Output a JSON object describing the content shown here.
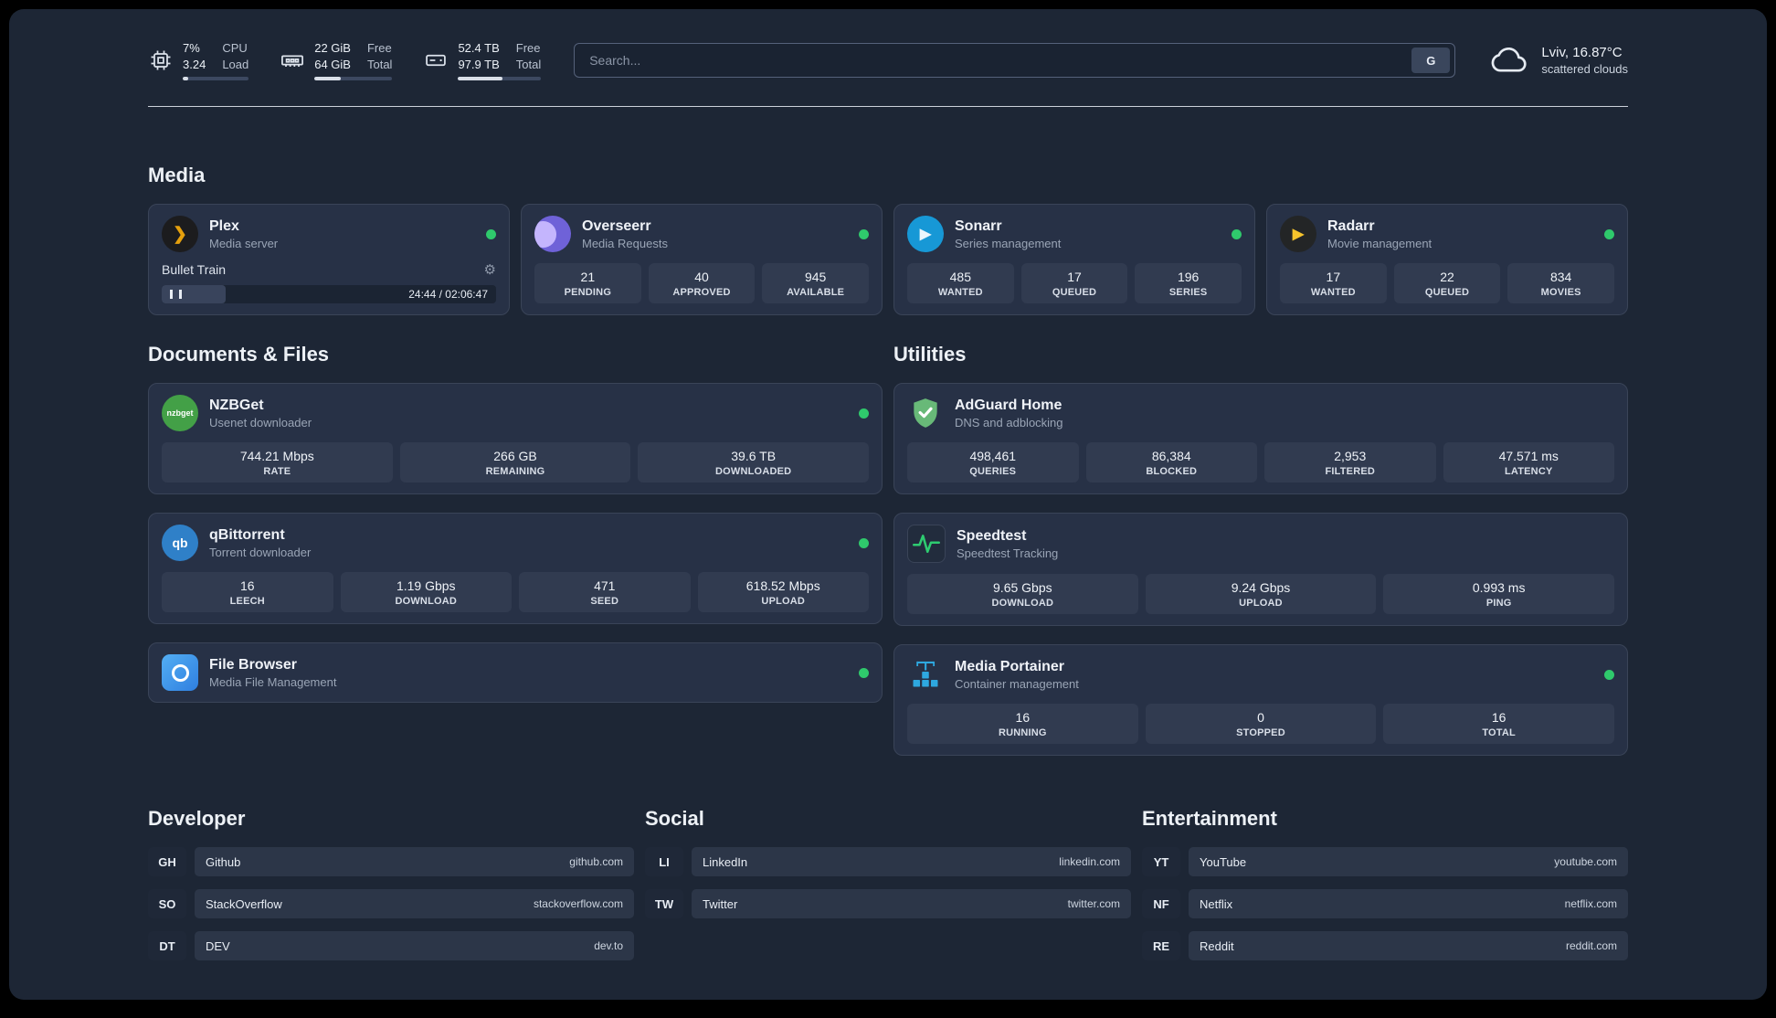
{
  "topbar": {
    "cpu": {
      "pct": "7%",
      "load": "3.24",
      "label_top": "CPU",
      "label_bottom": "Load",
      "bar_width": "8%"
    },
    "ram": {
      "free": "22 GiB",
      "total": "64 GiB",
      "label_top": "Free",
      "label_bottom": "Total",
      "bar_width": "34%"
    },
    "disk": {
      "free": "52.4 TB",
      "total": "97.9 TB",
      "label_top": "Free",
      "label_bottom": "Total",
      "bar_width": "53%"
    },
    "search_placeholder": "Search...",
    "search_engine": "G",
    "weather_location": "Lviv, 16.87°C",
    "weather_condition": "scattered clouds"
  },
  "media": {
    "title": "Media",
    "plex": {
      "name": "Plex",
      "desc": "Media server",
      "now_playing": "Bullet Train",
      "time": "24:44 / 02:06:47",
      "progress_width": "19%"
    },
    "overseerr": {
      "name": "Overseerr",
      "desc": "Media Requests",
      "stats": [
        {
          "value": "21",
          "label": "PENDING"
        },
        {
          "value": "40",
          "label": "APPROVED"
        },
        {
          "value": "945",
          "label": "AVAILABLE"
        }
      ]
    },
    "sonarr": {
      "name": "Sonarr",
      "desc": "Series management",
      "stats": [
        {
          "value": "485",
          "label": "WANTED"
        },
        {
          "value": "17",
          "label": "QUEUED"
        },
        {
          "value": "196",
          "label": "SERIES"
        }
      ]
    },
    "radarr": {
      "name": "Radarr",
      "desc": "Movie management",
      "stats": [
        {
          "value": "17",
          "label": "WANTED"
        },
        {
          "value": "22",
          "label": "QUEUED"
        },
        {
          "value": "834",
          "label": "MOVIES"
        }
      ]
    }
  },
  "documents": {
    "title": "Documents & Files",
    "nzbget": {
      "name": "NZBGet",
      "desc": "Usenet downloader",
      "stats": [
        {
          "value": "744.21 Mbps",
          "label": "RATE"
        },
        {
          "value": "266 GB",
          "label": "REMAINING"
        },
        {
          "value": "39.6 TB",
          "label": "DOWNLOADED"
        }
      ]
    },
    "qbittorrent": {
      "name": "qBittorrent",
      "desc": "Torrent downloader",
      "stats": [
        {
          "value": "16",
          "label": "LEECH"
        },
        {
          "value": "1.19 Gbps",
          "label": "DOWNLOAD"
        },
        {
          "value": "471",
          "label": "SEED"
        },
        {
          "value": "618.52 Mbps",
          "label": "UPLOAD"
        }
      ]
    },
    "filebrowser": {
      "name": "File Browser",
      "desc": "Media File Management"
    }
  },
  "utilities": {
    "title": "Utilities",
    "adguard": {
      "name": "AdGuard Home",
      "desc": "DNS and adblocking",
      "stats": [
        {
          "value": "498,461",
          "label": "QUERIES"
        },
        {
          "value": "86,384",
          "label": "BLOCKED"
        },
        {
          "value": "2,953",
          "label": "FILTERED"
        },
        {
          "value": "47.571 ms",
          "label": "LATENCY"
        }
      ]
    },
    "speedtest": {
      "name": "Speedtest",
      "desc": "Speedtest Tracking",
      "stats": [
        {
          "value": "9.65 Gbps",
          "label": "DOWNLOAD"
        },
        {
          "value": "9.24 Gbps",
          "label": "UPLOAD"
        },
        {
          "value": "0.993 ms",
          "label": "PING"
        }
      ]
    },
    "portainer": {
      "name": "Media Portainer",
      "desc": "Container management",
      "stats": [
        {
          "value": "16",
          "label": "RUNNING"
        },
        {
          "value": "0",
          "label": "STOPPED"
        },
        {
          "value": "16",
          "label": "TOTAL"
        }
      ]
    }
  },
  "bookmarks": {
    "developer": {
      "title": "Developer",
      "items": [
        {
          "abbr": "GH",
          "name": "Github",
          "domain": "github.com"
        },
        {
          "abbr": "SO",
          "name": "StackOverflow",
          "domain": "stackoverflow.com"
        },
        {
          "abbr": "DT",
          "name": "DEV",
          "domain": "dev.to"
        }
      ]
    },
    "social": {
      "title": "Social",
      "items": [
        {
          "abbr": "LI",
          "name": "LinkedIn",
          "domain": "linkedin.com"
        },
        {
          "abbr": "TW",
          "name": "Twitter",
          "domain": "twitter.com"
        }
      ]
    },
    "entertainment": {
      "title": "Entertainment",
      "items": [
        {
          "abbr": "YT",
          "name": "YouTube",
          "domain": "youtube.com"
        },
        {
          "abbr": "NF",
          "name": "Netflix",
          "domain": "netflix.com"
        },
        {
          "abbr": "RE",
          "name": "Reddit",
          "domain": "reddit.com"
        }
      ]
    }
  },
  "icons": {
    "gear": "⚙",
    "plex_chevron": "❯",
    "play": "▶",
    "nzbget_label": "nzbget",
    "qb_label": "qb"
  },
  "colors": {
    "status_green": "#2fc96c",
    "background": "#1d2635",
    "card": "#273146",
    "tile": "#313b50"
  }
}
